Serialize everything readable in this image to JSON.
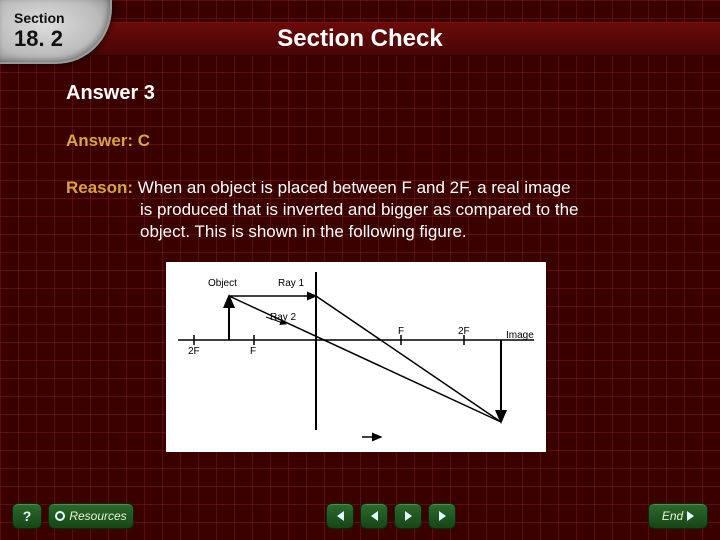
{
  "badge": {
    "label": "Section",
    "number": "18. 2"
  },
  "title": "Section Check",
  "heading": "Answer 3",
  "answer": {
    "label": "Answer:",
    "value": " C"
  },
  "reason": {
    "label": "Reason:",
    "line1": " When an object is placed between F and 2F, a real image",
    "line2": "is produced that is inverted and bigger as compared to the",
    "line3": "object. This is shown in the following figure."
  },
  "figure": {
    "labels": {
      "object": "Object",
      "ray1": "Ray 1",
      "ray2": "Ray 2",
      "left2F": "2F",
      "leftF": "F",
      "rightF": "F",
      "right2F": "2F",
      "image": "Image"
    }
  },
  "footer": {
    "resources": "Resources",
    "end": "End"
  }
}
